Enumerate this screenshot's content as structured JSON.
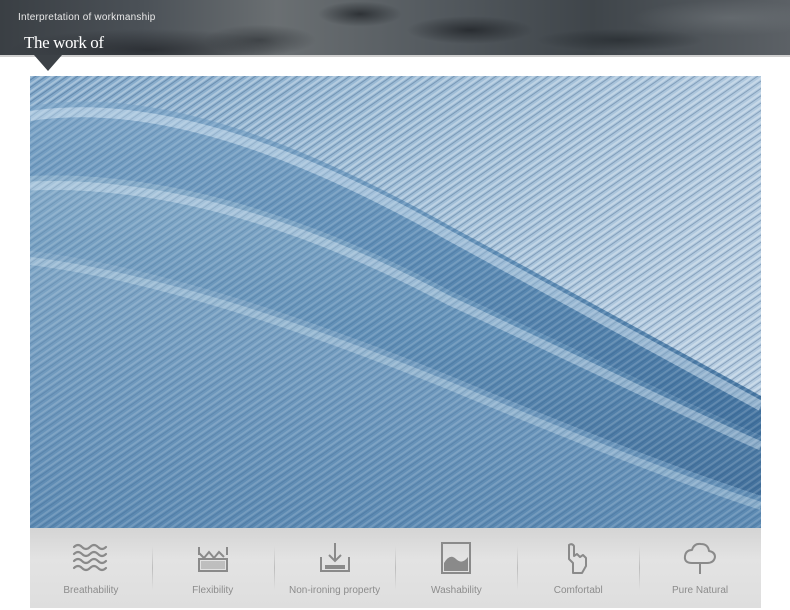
{
  "header": {
    "subtitle": "Interpretation of workmanship",
    "title": "The work of"
  },
  "photo": {
    "description_color": "#6f98bd"
  },
  "features": [
    {
      "label": "Breathability",
      "icon": "waves-icon"
    },
    {
      "label": "Flexibility",
      "icon": "stretch-icon"
    },
    {
      "label": "Non-ironing property",
      "icon": "no-iron-icon"
    },
    {
      "label": "Washability",
      "icon": "wash-icon"
    },
    {
      "label": "Comfortabl",
      "icon": "hand-icon"
    },
    {
      "label": "Pure Natural",
      "icon": "tree-icon"
    }
  ],
  "colors": {
    "icon": "#8a8a8a",
    "label": "#8c8c8c",
    "denim": "#6f98bd"
  }
}
